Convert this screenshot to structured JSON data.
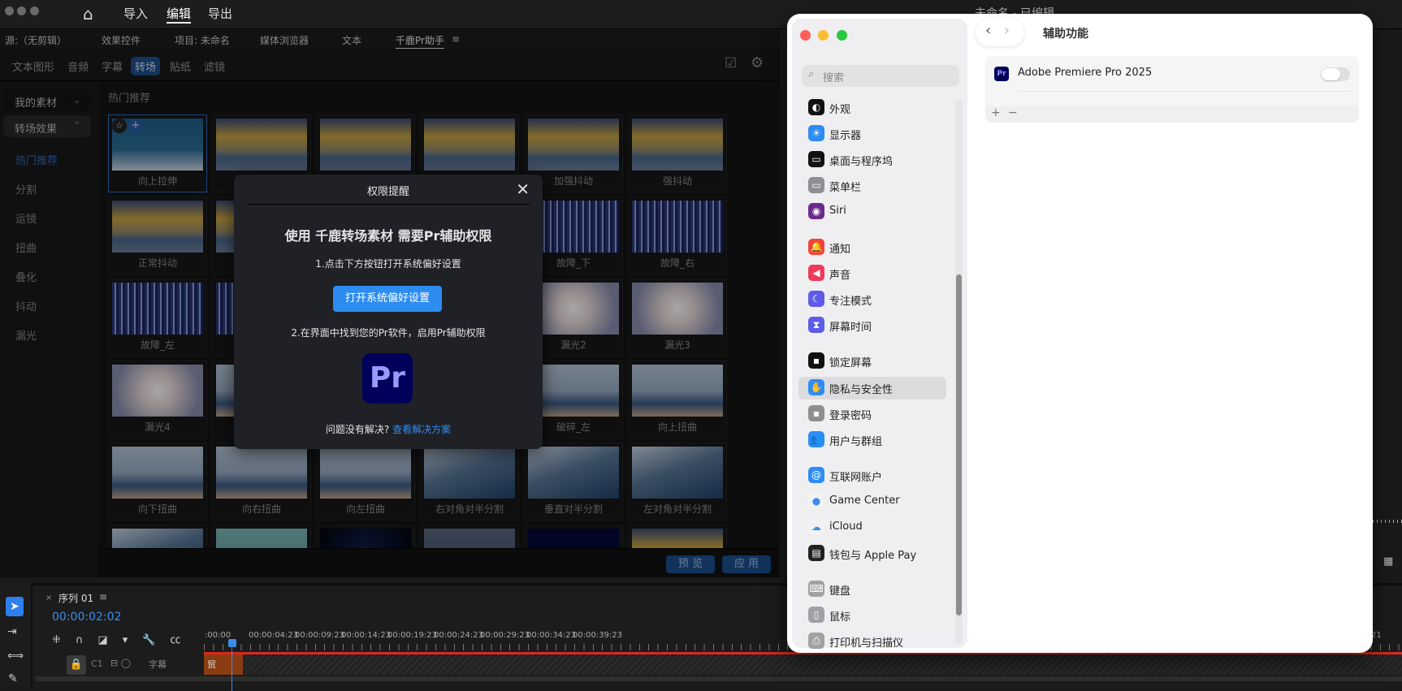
{
  "premiere": {
    "window_title": "未命名 - 已编辑",
    "top_nav": [
      "导入",
      "编辑",
      "导出"
    ],
    "active_nav": "编辑",
    "panel_tabs": [
      "源:（无剪辑）",
      "效果控件",
      "项目: 未命名",
      "媒体浏览器",
      "文本",
      "千鹿Pr助手"
    ],
    "sub_tabs": [
      "文本图形",
      "音频",
      "字幕",
      "转场",
      "贴纸",
      "滤镜"
    ],
    "active_sub_tab": "转场",
    "left_nav": {
      "groups": [
        "我的素材",
        "转场效果"
      ],
      "items": [
        "热门推荐",
        "分割",
        "运镜",
        "扭曲",
        "叠化",
        "抖动",
        "漏光"
      ],
      "active_item": "热门推荐"
    },
    "section_title": "热门推荐",
    "tiles": [
      {
        "label": "向上拉伸",
        "thumb": "mountain",
        "selected": true
      },
      {
        "label": "",
        "thumb": "sky"
      },
      {
        "label": "",
        "thumb": "sky"
      },
      {
        "label": "",
        "thumb": "sky"
      },
      {
        "label": "加强抖动",
        "thumb": "sky"
      },
      {
        "label": "强抖动",
        "thumb": "sky"
      },
      {
        "label": "正常抖动",
        "thumb": "sky"
      },
      {
        "label": "",
        "thumb": "sky"
      },
      {
        "label": "",
        "thumb": "glitch"
      },
      {
        "label": "",
        "thumb": "glitch"
      },
      {
        "label": "故障_下",
        "thumb": "glitch"
      },
      {
        "label": "故障_右",
        "thumb": "glitch"
      },
      {
        "label": "故障_左",
        "thumb": "glitch"
      },
      {
        "label": "",
        "thumb": "glitch"
      },
      {
        "label": "",
        "thumb": "leak"
      },
      {
        "label": "",
        "thumb": "leak"
      },
      {
        "label": "漏光2",
        "thumb": "leak"
      },
      {
        "label": "漏光3",
        "thumb": "leak"
      },
      {
        "label": "漏光4",
        "thumb": "leak"
      },
      {
        "label": "",
        "thumb": "skater"
      },
      {
        "label": "",
        "thumb": "skater"
      },
      {
        "label": "",
        "thumb": "skater"
      },
      {
        "label": "破碎_左",
        "thumb": "skater"
      },
      {
        "label": "向上扭曲",
        "thumb": "skater"
      },
      {
        "label": "向下扭曲",
        "thumb": "skater"
      },
      {
        "label": "向右扭曲",
        "thumb": "skater"
      },
      {
        "label": "向左扭曲",
        "thumb": "skater"
      },
      {
        "label": "右对角对半分割",
        "thumb": "building"
      },
      {
        "label": "垂直对半分割",
        "thumb": "building"
      },
      {
        "label": "左对角对半分割",
        "thumb": "building"
      },
      {
        "label": "",
        "thumb": "building"
      },
      {
        "label": "",
        "thumb": "mint"
      },
      {
        "label": "",
        "thumb": "dark"
      },
      {
        "label": "",
        "thumb": "stars"
      },
      {
        "label": "",
        "thumb": "navy"
      },
      {
        "label": "",
        "thumb": "sky"
      }
    ],
    "bottom_buttons": {
      "preview": "预 览",
      "apply": "应 用"
    },
    "dialog": {
      "title": "权限提醒",
      "heading": "使用 千鹿转场素材 需要Pr辅助权限",
      "step1": "1.点击下方按钮打开系统偏好设置",
      "button": "打开系统偏好设置",
      "step2": "2.在界面中找到您的Pr软件，启用Pr辅助权限",
      "logo": "Pr",
      "help": "问题没有解决?",
      "help_link": "查看解决方案"
    },
    "timeline": {
      "sequence": "序列 01",
      "timecode": "00:00:02:02",
      "ruler": [
        ":00:00",
        "00:00:04:23",
        "00:00:09:23",
        "00:00:14:23",
        "00:00:19:23",
        "00:00:24:23",
        "00:00:29:23",
        "00:00:34:23",
        "00:00:39:23"
      ],
      "ruler_end": "21",
      "track": {
        "name": "C1",
        "label": "字幕"
      },
      "clip_label": "贸"
    },
    "colors": {
      "accent": "#2d8cf0",
      "timecode": "#3b8eea",
      "playhead": "#3b8eea",
      "in_out": "#e0261c"
    }
  },
  "settings": {
    "title": "辅助功能",
    "search_placeholder": "搜索",
    "items": [
      {
        "label": "外观",
        "color": "#111",
        "icon": "◐"
      },
      {
        "label": "显示器",
        "color": "#2f8cf5",
        "icon": "☀"
      },
      {
        "label": "桌面与程序坞",
        "color": "#111",
        "icon": "▭"
      },
      {
        "label": "菜单栏",
        "color": "#8e8e93",
        "icon": "▭"
      },
      {
        "label": "Siri",
        "color": "#6a2b8a",
        "icon": "◉"
      },
      {
        "label": "通知",
        "color": "#f0453a",
        "icon": "🔔"
      },
      {
        "label": "声音",
        "color": "#f03a5a",
        "icon": "◀"
      },
      {
        "label": "专注模式",
        "color": "#5e5ce6",
        "icon": "☾"
      },
      {
        "label": "屏幕时间",
        "color": "#5e5ce6",
        "icon": "⧗"
      },
      {
        "label": "锁定屏幕",
        "color": "#111",
        "icon": "▪"
      },
      {
        "label": "隐私与安全性",
        "color": "#2f8cf5",
        "icon": "✋",
        "selected": true
      },
      {
        "label": "登录密码",
        "color": "#8e8e93",
        "icon": "▪"
      },
      {
        "label": "用户与群组",
        "color": "#2f8cf5",
        "icon": "👥"
      },
      {
        "label": "互联网账户",
        "color": "#2f8cf5",
        "icon": "@"
      },
      {
        "label": "Game Center",
        "color": "#f2f2f2",
        "icon": "●"
      },
      {
        "label": "iCloud",
        "color": "#f2f2f2",
        "icon": "☁"
      },
      {
        "label": "钱包与 Apple Pay",
        "color": "#222",
        "icon": "▤"
      },
      {
        "label": "键盘",
        "color": "#a0a0a5",
        "icon": "⌨"
      },
      {
        "label": "鼠标",
        "color": "#a0a0a5",
        "icon": "▯"
      },
      {
        "label": "打印机与扫描仪",
        "color": "#a0a0a5",
        "icon": "⎙"
      }
    ],
    "app_row": {
      "name": "Adobe Premiere Pro 2025",
      "icon": "Pr",
      "enabled": false
    },
    "add": "+",
    "remove": "−"
  }
}
